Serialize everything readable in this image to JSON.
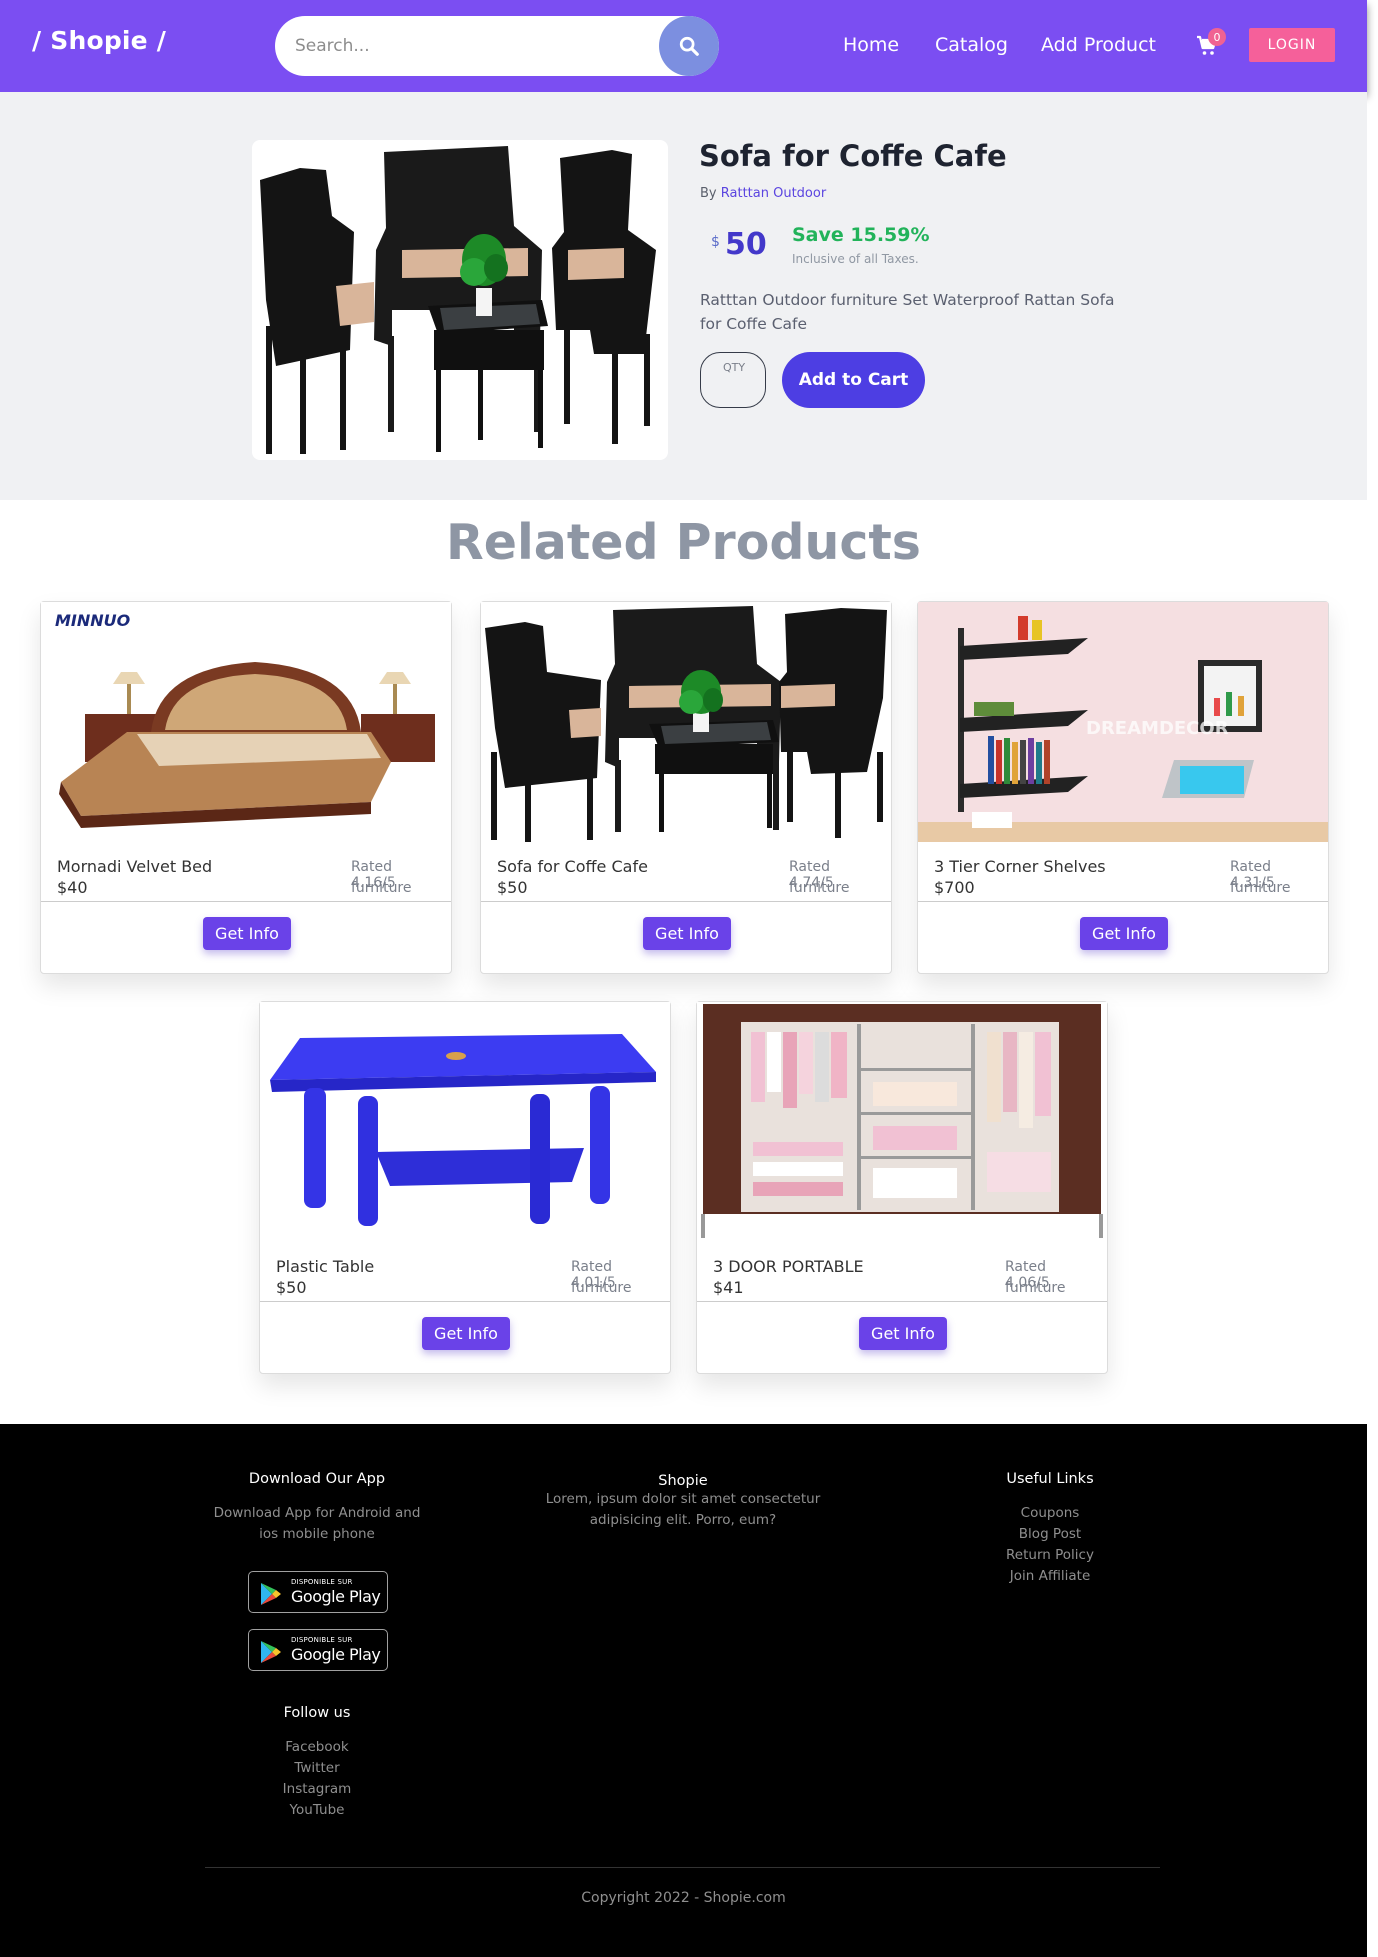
{
  "nav": {
    "brand": "/ Shopie /",
    "search_placeholder": "Search...",
    "links": [
      "Home",
      "Catalog",
      "Add Product"
    ],
    "cart_count": "0",
    "login": "LOGIN",
    "color": "#7b4ef2"
  },
  "product": {
    "title": "Sofa for Coffe Cafe",
    "by_prefix": "By",
    "brand": "Ratttan Outdoor",
    "currency": "$",
    "price": "50",
    "save": "Save 15.59%",
    "tax_note": "Inclusive of all Taxes.",
    "description": "Ratttan Outdoor furniture Set Waterproof Rattan Sofa for Coffe Cafe",
    "qty_label": "QTY",
    "add_to_cart": "Add to Cart"
  },
  "related": {
    "title": "Related Products",
    "button_label": "Get Info",
    "items": [
      {
        "name": "Mornadi Velvet Bed",
        "price": "$40",
        "rating": "Rated 4.16/5",
        "category": "furniture",
        "image": "bed-image",
        "logo_text": "MINNUO"
      },
      {
        "name": "Sofa for Coffe Cafe",
        "price": "$50",
        "rating": "Rated 4.74/5",
        "category": "furniture",
        "image": "rattan-set-image"
      },
      {
        "name": "3 Tier Corner Shelves",
        "price": "$700",
        "rating": "Rated 4.31/5",
        "category": "furniture",
        "image": "shelves-image",
        "watermark": "DREAMDECOR"
      },
      {
        "name": "Plastic Table",
        "price": "$50",
        "rating": "Rated 4.01/5",
        "category": "furniture",
        "image": "plastic-table-image"
      },
      {
        "name": "3 DOOR PORTABLE",
        "price": "$41",
        "rating": "Rated 4.06/5",
        "category": "furniture",
        "image": "wardrobe-image"
      }
    ]
  },
  "footer": {
    "download": {
      "title": "Download Our App",
      "text": "Download App for Android and ios mobile phone",
      "badge_small": "DISPONIBLE SUR",
      "badge_big": "Google Play"
    },
    "follow": {
      "title": "Follow us",
      "links": [
        "Facebook",
        "Twitter",
        "Instagram",
        "YouTube"
      ]
    },
    "about": {
      "title": "Shopie",
      "text": "Lorem, ipsum dolor sit amet consectetur adipisicing elit. Porro, eum?"
    },
    "useful": {
      "title": "Useful Links",
      "links": [
        "Coupons",
        "Blog Post",
        "Return Policy",
        "Join Affiliate"
      ]
    },
    "copyright": "Copyright 2022 - Shopie.com"
  }
}
